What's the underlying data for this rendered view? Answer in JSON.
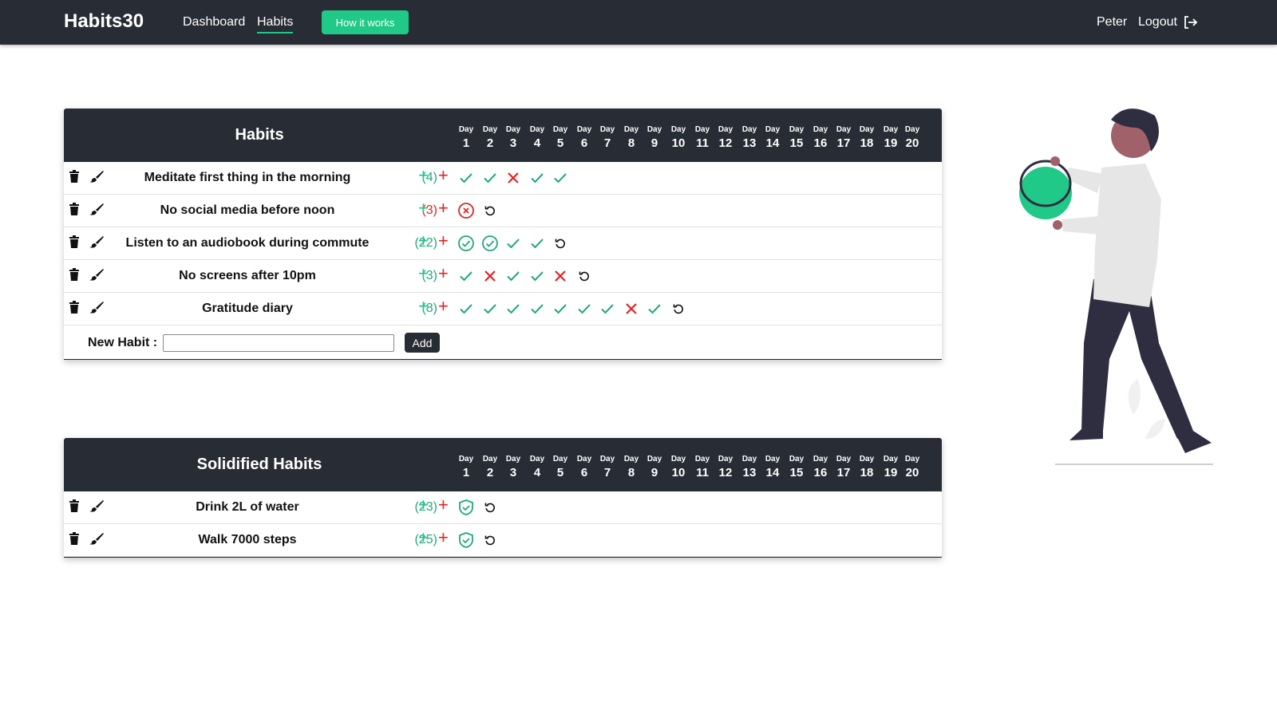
{
  "nav": {
    "brand": "Habits30",
    "links": [
      "Dashboard",
      "Habits"
    ],
    "active": "Habits",
    "how_label": "How it works",
    "user": "Peter",
    "logout_label": "Logout"
  },
  "day_label": "Day",
  "days": [
    "1",
    "2",
    "3",
    "4",
    "5",
    "6",
    "7",
    "8",
    "9",
    "10",
    "11",
    "12",
    "13",
    "14",
    "15",
    "16",
    "17",
    "18",
    "19",
    "20"
  ],
  "habits_table": {
    "title": "Habits",
    "rows": [
      {
        "name": "Meditate first thing in the morning",
        "count": "(4)",
        "count_color": "green",
        "marks": [
          "check",
          "check",
          "x",
          "check",
          "check"
        ]
      },
      {
        "name": "No social media before noon",
        "count": "(3)",
        "count_color": "red",
        "marks": [
          "x-circle",
          "undo"
        ]
      },
      {
        "name": "Listen to an audiobook during commute",
        "count": "(22)",
        "count_color": "green",
        "marks": [
          "check-circle",
          "check-circle",
          "check",
          "check",
          "undo"
        ]
      },
      {
        "name": "No screens after 10pm",
        "count": "(3)",
        "count_color": "green",
        "marks": [
          "check",
          "x",
          "check",
          "check",
          "x",
          "undo"
        ]
      },
      {
        "name": "Gratitude diary",
        "count": "(8)",
        "count_color": "green",
        "marks": [
          "check",
          "check",
          "check",
          "check",
          "check",
          "check",
          "check",
          "x",
          "check",
          "undo"
        ]
      }
    ],
    "new_habit_label": "New Habit :",
    "new_habit_value": "",
    "add_label": "Add"
  },
  "solid_table": {
    "title": "Solidified Habits",
    "rows": [
      {
        "name": "Drink 2L of water",
        "count": "(23)",
        "count_color": "green",
        "marks": [
          "shield",
          "undo"
        ]
      },
      {
        "name": "Walk 7000 steps",
        "count": "(25)",
        "count_color": "green",
        "marks": [
          "shield",
          "undo"
        ]
      }
    ]
  },
  "colors": {
    "brand_green": "#20c987",
    "dark": "#282c34",
    "check_green": "#20a87a",
    "fail_red": "#e52222"
  },
  "icons": {
    "row_actions": [
      "trash-icon",
      "brush-icon"
    ],
    "logout": "logout-icon"
  }
}
